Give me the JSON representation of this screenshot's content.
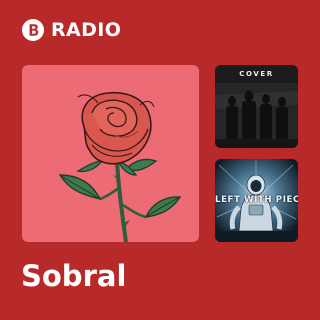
{
  "brand": {
    "label": "RADIO",
    "logo_icon": "deezer-logo-icon",
    "accent_color": "#b82a2a"
  },
  "artist": {
    "name": "Sobral"
  },
  "covers": {
    "main": {
      "icon": "rose-illustration",
      "background": "#ec6b74"
    },
    "tile_1": {
      "text": "COVER"
    },
    "tile_2": {
      "text": "LEFT WITH PIECES"
    }
  }
}
